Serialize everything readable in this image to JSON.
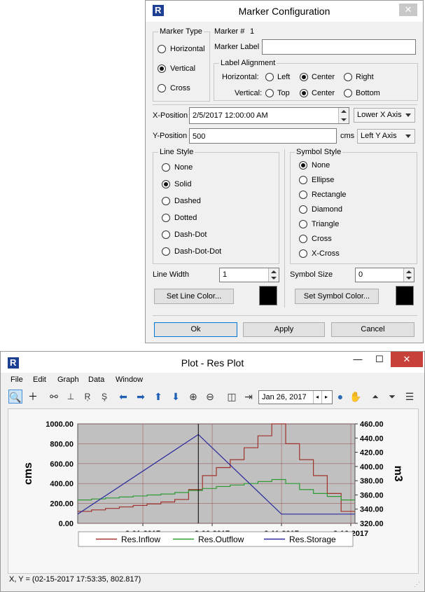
{
  "dialog": {
    "title": "Marker Configuration",
    "close_glyph": "✕",
    "app_icon": "R",
    "marker_type": {
      "legend": "Marker Type",
      "options": [
        "Horizontal",
        "Vertical",
        "Cross"
      ],
      "selected": "Vertical"
    },
    "marker_number_label": "Marker #",
    "marker_number": "1",
    "marker_label_label": "Marker Label",
    "marker_label_value": "",
    "label_alignment": {
      "legend": "Label Alignment",
      "horizontal_label": "Horizontal:",
      "horizontal_options": [
        "Left",
        "Center",
        "Right"
      ],
      "horizontal_selected": "Center",
      "vertical_label": "Vertical:",
      "vertical_options": [
        "Top",
        "Center",
        "Bottom"
      ],
      "vertical_selected": "Center"
    },
    "x_position_label": "X-Position",
    "x_position_value": "2/5/2017 12:00:00 AM",
    "x_axis_select": "Lower X Axis",
    "y_position_label": "Y-Position",
    "y_position_value": "500",
    "y_units": "cms",
    "y_axis_select": "Left Y Axis",
    "line_style": {
      "legend": "Line Style",
      "options": [
        "None",
        "Solid",
        "Dashed",
        "Dotted",
        "Dash-Dot",
        "Dash-Dot-Dot"
      ],
      "selected": "Solid"
    },
    "symbol_style": {
      "legend": "Symbol Style",
      "options": [
        "None",
        "Ellipse",
        "Rectangle",
        "Diamond",
        "Triangle",
        "Cross",
        "X-Cross"
      ],
      "selected": "None"
    },
    "line_width_label": "Line Width",
    "line_width_value": "1",
    "symbol_size_label": "Symbol Size",
    "symbol_size_value": "0",
    "set_line_color": "Set Line Color...",
    "set_symbol_color": "Set Symbol Color...",
    "line_color": "#000000",
    "symbol_color": "#000000",
    "ok": "Ok",
    "apply": "Apply",
    "cancel": "Cancel"
  },
  "plot_window": {
    "title": "Plot - Res Plot",
    "app_icon": "R",
    "controls": {
      "minimize": "—",
      "maximize": "☐",
      "close": "✕"
    },
    "menu": [
      "File",
      "Edit",
      "Graph",
      "Data",
      "Window"
    ],
    "toolbar_icons": [
      "zoom-icon",
      "crosshair-icon",
      "link-icon",
      "axis-x-icon",
      "axis-r-icon",
      "axis-s-icon",
      "arrow-left-icon",
      "arrow-right-icon",
      "arrow-up-icon",
      "arrow-down-icon",
      "zoom-in-icon",
      "zoom-out-icon",
      "split-icon",
      "collapse-icon",
      "globe-icon",
      "hand-icon",
      "chart-up-icon",
      "chart-down-icon",
      "chart-menu-icon"
    ],
    "date_value": "Jan 26, 2017",
    "status": "X, Y = (02-15-2017 17:53:35, 802.817)"
  },
  "chart_data": {
    "type": "line",
    "title": "",
    "xlabel": "",
    "ylabel": "cms",
    "y2label": "m3",
    "x_tick_labels": [
      "2-01-2017",
      "2-06-2017",
      "2-11-2017",
      "2-16-2017"
    ],
    "x_ticks_day": [
      5,
      10,
      15,
      20
    ],
    "xlim_day": [
      0.3,
      20.3
    ],
    "ylim": [
      0,
      1000
    ],
    "y_tick_labels": [
      "1000.00",
      "800.00",
      "600.00",
      "400.00",
      "200.00",
      "0.00"
    ],
    "y2lim": [
      320,
      460
    ],
    "y2_tick_labels": [
      "460.00",
      "440.00",
      "420.00",
      "400.00",
      "380.00",
      "360.00",
      "340.00",
      "320.00"
    ],
    "grid": true,
    "marker": {
      "x": "2/5/2017 12:00:00 AM",
      "x_day": 9.0
    },
    "legend_position": "bottom",
    "series": [
      {
        "name": "Res.Inflow",
        "color": "#a0322c",
        "axis": "left",
        "step": true,
        "x": [
          0.3,
          1.3,
          2.3,
          3.3,
          4.3,
          5.3,
          6.3,
          7.3,
          8.3,
          9.3,
          10.3,
          11.3,
          12.3,
          13.3,
          14.3,
          15.3,
          16.3,
          17.3,
          18.3,
          19.3,
          20.3
        ],
        "y": [
          120,
          135,
          150,
          165,
          180,
          195,
          215,
          240,
          340,
          480,
          560,
          640,
          760,
          880,
          1000,
          800,
          640,
          480,
          300,
          120,
          120
        ]
      },
      {
        "name": "Res.Outflow",
        "color": "#2e9b34",
        "axis": "left",
        "step": true,
        "x": [
          0.3,
          1.3,
          2.3,
          3.3,
          4.3,
          5.3,
          6.3,
          7.3,
          8.3,
          9.3,
          10.3,
          11.3,
          12.3,
          13.3,
          14.3,
          15.3,
          16.3,
          17.3,
          18.3,
          19.3,
          20.3
        ],
        "y": [
          235,
          245,
          255,
          265,
          275,
          285,
          295,
          310,
          330,
          350,
          370,
          385,
          400,
          420,
          440,
          400,
          340,
          300,
          270,
          235,
          235
        ]
      },
      {
        "name": "Res.Storage",
        "color": "#2a2a9c",
        "axis": "right",
        "step": false,
        "x": [
          0.3,
          9.0,
          15.0,
          20.3
        ],
        "y": [
          333,
          445,
          333,
          333
        ]
      }
    ]
  }
}
